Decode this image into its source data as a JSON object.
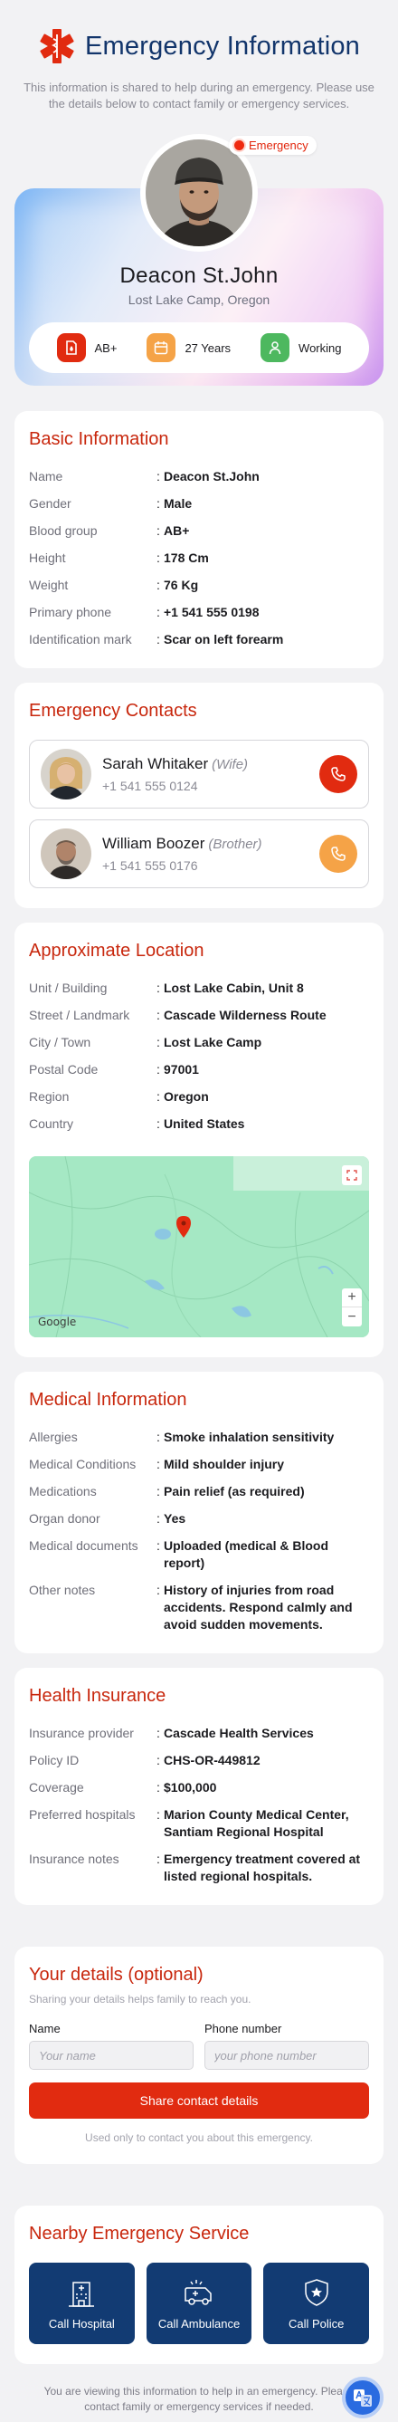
{
  "header": {
    "title": "Emergency Information",
    "subtitle": "This information is shared to help during an emergency. Please use the details below to contact family or emergency services."
  },
  "profile": {
    "badge": "Emergency",
    "name": "Deacon St.John",
    "location": "Lost Lake Camp, Oregon",
    "stats": [
      {
        "icon": "blood-drop-icon",
        "value": "AB+"
      },
      {
        "icon": "calendar-icon",
        "value": "27 Years"
      },
      {
        "icon": "person-icon",
        "value": "Working"
      }
    ]
  },
  "basic": {
    "title": "Basic Information",
    "rows": [
      {
        "k": "Name",
        "v": "Deacon St.John"
      },
      {
        "k": "Gender",
        "v": "Male"
      },
      {
        "k": "Blood group",
        "v": "AB+"
      },
      {
        "k": "Height",
        "v": "178 Cm"
      },
      {
        "k": "Weight",
        "v": "76 Kg"
      },
      {
        "k": "Primary phone",
        "v": "+1 541 555 0198"
      },
      {
        "k": "Identification mark",
        "v": "Scar on left forearm"
      }
    ]
  },
  "contacts": {
    "title": "Emergency Contacts",
    "items": [
      {
        "name": "Sarah Whitaker",
        "relation": "(Wife)",
        "phone": "+1 541 555 0124",
        "color": "#e12b10"
      },
      {
        "name": "William Boozer",
        "relation": "(Brother)",
        "phone": "+1 541 555 0176",
        "color": "#f5a347"
      }
    ]
  },
  "location": {
    "title": "Approximate Location",
    "rows": [
      {
        "k": "Unit / Building",
        "v": "Lost Lake Cabin, Unit 8"
      },
      {
        "k": "Street / Landmark",
        "v": "Cascade Wilderness Route"
      },
      {
        "k": "City / Town",
        "v": "Lost Lake Camp"
      },
      {
        "k": "Postal Code",
        "v": "97001"
      },
      {
        "k": "Region",
        "v": "Oregon"
      },
      {
        "k": "Country",
        "v": "United States"
      }
    ],
    "map_logo": "Google"
  },
  "medical": {
    "title": "Medical Information",
    "rows": [
      {
        "k": "Allergies",
        "v": "Smoke inhalation sensitivity"
      },
      {
        "k": "Medical Conditions",
        "v": "Mild shoulder injury"
      },
      {
        "k": "Medications",
        "v": "Pain relief (as required)"
      },
      {
        "k": "Organ donor",
        "v": "Yes"
      },
      {
        "k": "Medical documents",
        "v": "Uploaded (medical & Blood report)"
      },
      {
        "k": "Other notes",
        "v": "History of injuries from road accidents. Respond calmly and avoid sudden movements."
      }
    ]
  },
  "insurance": {
    "title": "Health Insurance",
    "rows": [
      {
        "k": "Insurance provider",
        "v": "Cascade Health Services"
      },
      {
        "k": "Policy ID",
        "v": "CHS-OR-449812"
      },
      {
        "k": "Coverage",
        "v": "$100,000"
      },
      {
        "k": "Preferred hospitals",
        "v": "Marion County Medical Center, Santiam Regional Hospital"
      },
      {
        "k": "Insurance notes",
        "v": "Emergency treatment covered at listed regional hospitals."
      }
    ]
  },
  "form": {
    "title": "Your details (optional)",
    "subtitle": "Sharing your details helps family to reach you.",
    "name_label": "Name",
    "name_placeholder": "Your name",
    "phone_label": "Phone number",
    "phone_placeholder": "your phone number",
    "button": "Share contact details",
    "note": "Used only to contact you about this emergency."
  },
  "services": {
    "title": "Nearby Emergency Service",
    "items": [
      {
        "icon": "hospital-icon",
        "label": "Call Hospital"
      },
      {
        "icon": "ambulance-icon",
        "label": "Call Ambulance"
      },
      {
        "icon": "police-badge-icon",
        "label": "Call Police"
      }
    ]
  },
  "footer": {
    "note": "You are viewing this information to help in an emergency. Please contact family or emergency services if needed."
  },
  "colors": {
    "accent_red": "#e12b10",
    "title_red": "#c8270d",
    "navy": "#123b73",
    "orange": "#f5a347",
    "green": "#4db85f"
  }
}
